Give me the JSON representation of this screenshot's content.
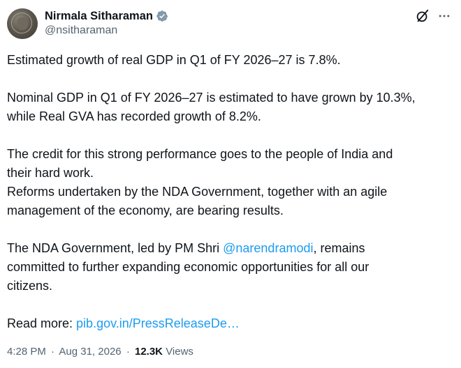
{
  "author": {
    "display_name": "Nirmala Sitharaman",
    "handle": "@nsitharaman",
    "verified": true,
    "verified_color": "#829aab"
  },
  "header_actions": {
    "grok_icon": "grok-slash-circle-icon",
    "more_icon": "more-horizontal-icon"
  },
  "tweet": {
    "line1": "Estimated growth of real GDP in Q1 of FY 2026–27 is 7.8%.",
    "line2a": "Nominal GDP in Q1 of FY 2026–27 is estimated to have grown by 10.3%,",
    "line2b": "while Real GVA has recorded growth of 8.2%.",
    "line3a": "The credit for this strong performance goes to the people of India and",
    "line3b": "their hard work.",
    "line4a": "Reforms undertaken by the NDA Government, together with an agile",
    "line4b": "management of the economy, are bearing results.",
    "line5a_pre": "The NDA Government, led by PM Shri ",
    "line5a_mention": "@narendramodi",
    "line5a_post": ", remains",
    "line5b": "committed to further expanding economic opportunities for all our",
    "line5c": "citizens.",
    "read_more_label": "Read more: ",
    "read_more_link": "pib.gov.in/PressReleaseDe…",
    "link_color": "#1d9bf0"
  },
  "meta": {
    "time": "4:28 PM",
    "separator": "·",
    "date": "Aug 31, 2026",
    "views_count": "12.3K",
    "views_label": "Views"
  }
}
